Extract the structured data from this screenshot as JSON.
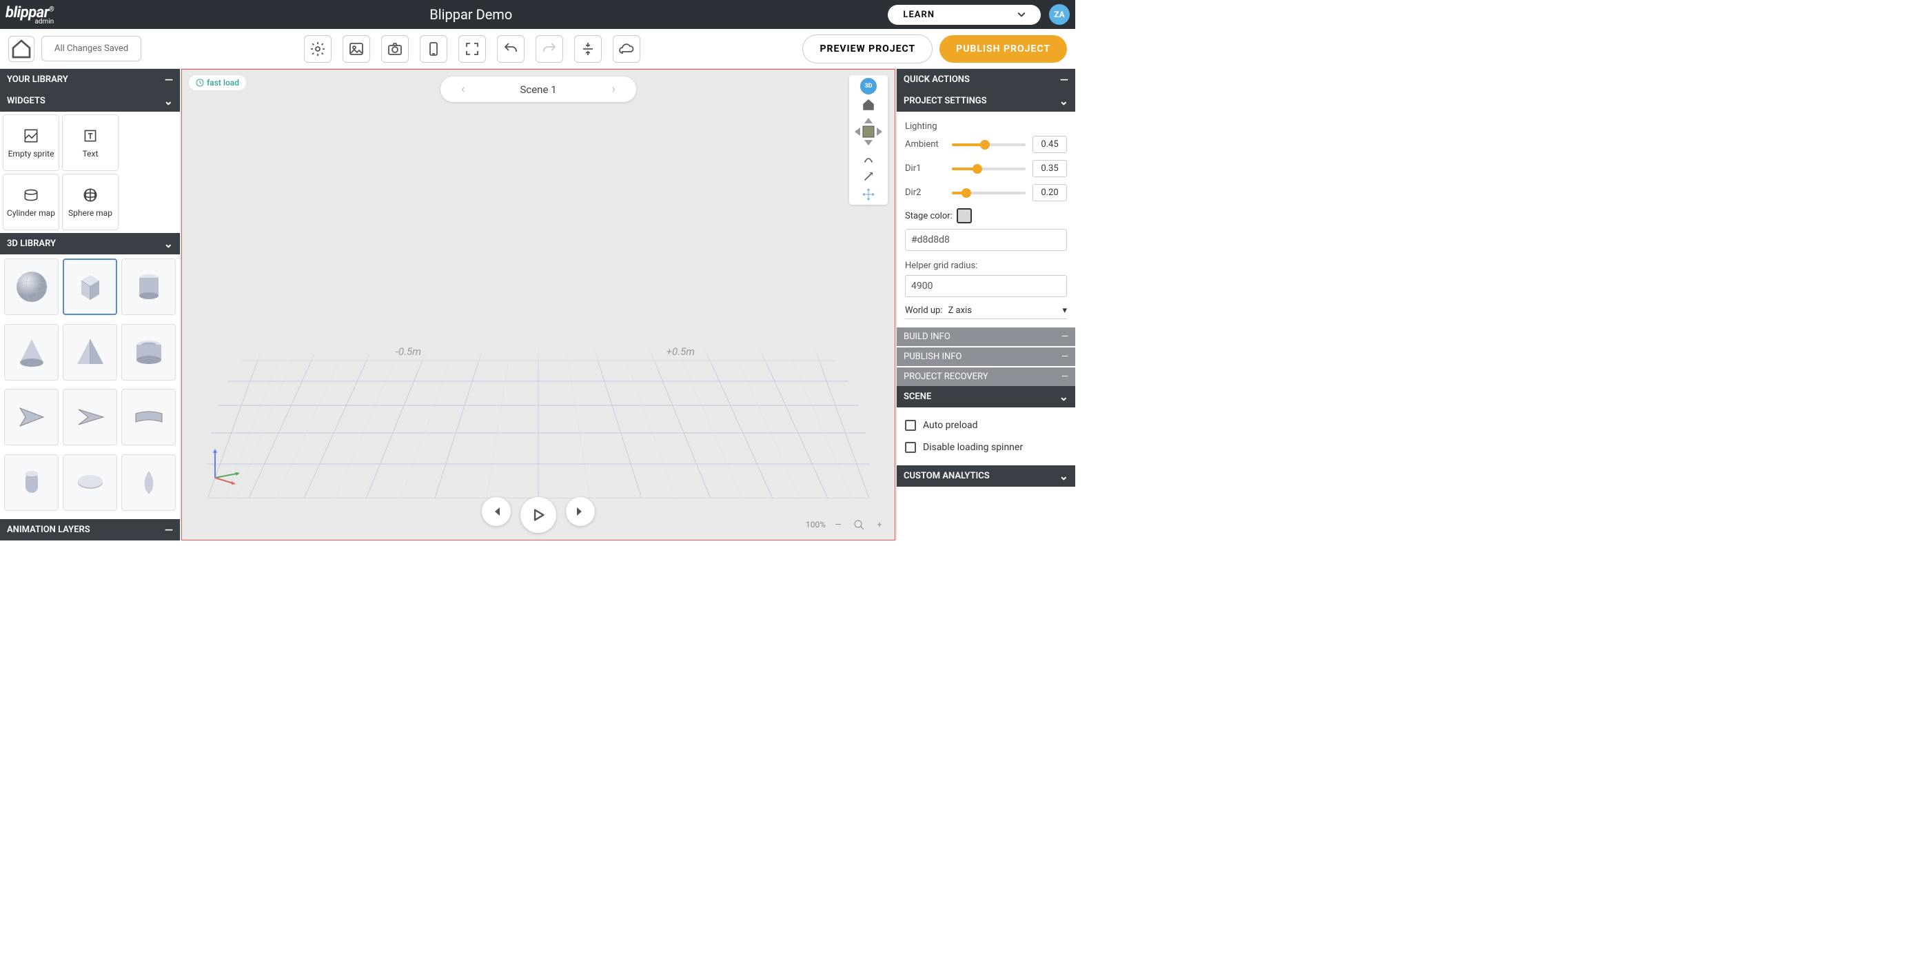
{
  "header": {
    "logo": "blippar",
    "logo_sub": "admin",
    "title": "Blippar Demo",
    "learn_label": "LEARN",
    "avatar_initials": "ZA"
  },
  "toolbar": {
    "save_status": "All Changes Saved",
    "preview_label": "PREVIEW PROJECT",
    "publish_label": "PUBLISH PROJECT"
  },
  "panels": {
    "your_library": "YOUR LIBRARY",
    "widgets": "WIDGETS",
    "three_d_library": "3D LIBRARY",
    "animation_layers": "ANIMATION LAYERS",
    "quick_actions": "QUICK ACTIONS",
    "project_settings": "PROJECT SETTINGS",
    "scene": "SCENE",
    "custom_analytics": "CUSTOM ANALYTICS"
  },
  "widgets": {
    "empty_sprite": "Empty sprite",
    "text": "Text",
    "cylinder_map": "Cylinder map",
    "sphere_map": "Sphere map"
  },
  "viewport": {
    "fast_load": "fast load",
    "scene_name": "Scene 1",
    "meas_left": "-0.5m",
    "meas_right": "+0.5m",
    "zoom": "100%",
    "badge3d": "3D"
  },
  "settings": {
    "lighting_label": "Lighting",
    "ambient_label": "Ambient",
    "ambient_val": "0.45",
    "dir1_label": "Dir1",
    "dir1_val": "0.35",
    "dir2_label": "Dir2",
    "dir2_val": "0.20",
    "stage_color_label": "Stage color:",
    "stage_color_val": "#d8d8d8",
    "grid_radius_label": "Helper grid radius:",
    "grid_radius_val": "4900",
    "world_up_label": "World up:",
    "world_up_val": "Z axis",
    "build_info": "BUILD INFO",
    "publish_info": "PUBLISH INFO",
    "project_recovery": "PROJECT RECOVERY",
    "auto_preload": "Auto preload",
    "disable_spinner": "Disable loading spinner"
  }
}
